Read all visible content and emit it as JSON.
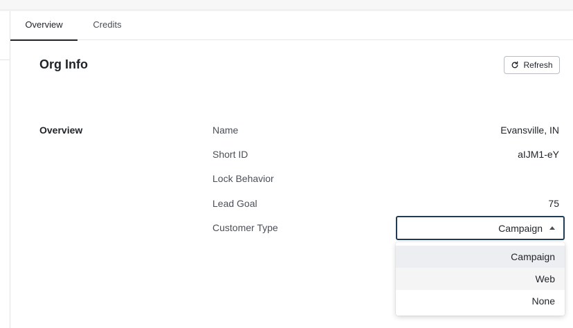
{
  "tabs": [
    {
      "label": "Overview",
      "active": true
    },
    {
      "label": "Credits",
      "active": false
    }
  ],
  "header": {
    "title": "Org Info",
    "refresh_label": "Refresh"
  },
  "section": {
    "label": "Overview",
    "fields": [
      {
        "label": "Name",
        "value": "Evansville, IN"
      },
      {
        "label": "Short ID",
        "value": "aIJM1-eY"
      },
      {
        "label": "Lock Behavior",
        "value": ""
      },
      {
        "label": "Lead Goal",
        "value": "75"
      },
      {
        "label": "Customer Type",
        "value": "Campaign"
      }
    ]
  },
  "customer_type_select": {
    "selected": "Campaign",
    "options": [
      "Campaign",
      "Web",
      "None"
    ]
  },
  "colors": {
    "select_border": "#1f3b57",
    "selected_option_bg": "#eceef2",
    "hover_option_bg": "#f5f5f6"
  }
}
